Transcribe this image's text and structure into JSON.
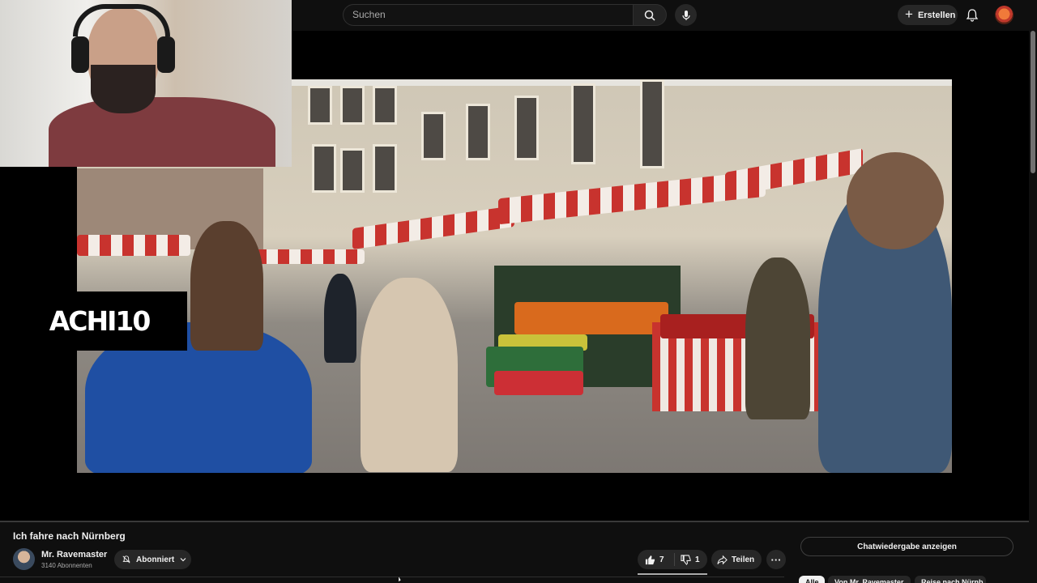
{
  "search": {
    "placeholder": "Suchen",
    "icon": "search-icon"
  },
  "header": {
    "create_label": "Erstellen",
    "icons": [
      "mic-icon",
      "bell-icon",
      "avatar"
    ]
  },
  "overlay": {
    "brand_text": "ACHI10"
  },
  "video": {
    "title": "Ich fahre nach Nürnberg"
  },
  "channel": {
    "name": "Mr. Ravemaster",
    "subscribers": "3140 Abonnenten",
    "subscribe_label": "Abonniert"
  },
  "actions": {
    "likes": "7",
    "dislikes": "1",
    "share_label": "Teilen",
    "more_label": "···"
  },
  "sidebar": {
    "chat_replay_label": "Chatwiedergabe anzeigen",
    "chips": [
      "Alle",
      "Von Mr. Ravemaster",
      "Reise nach Nürnb..."
    ]
  },
  "colors": {
    "accent": "#f1f1f1",
    "background": "#0f0f0f",
    "button": "#272727"
  }
}
